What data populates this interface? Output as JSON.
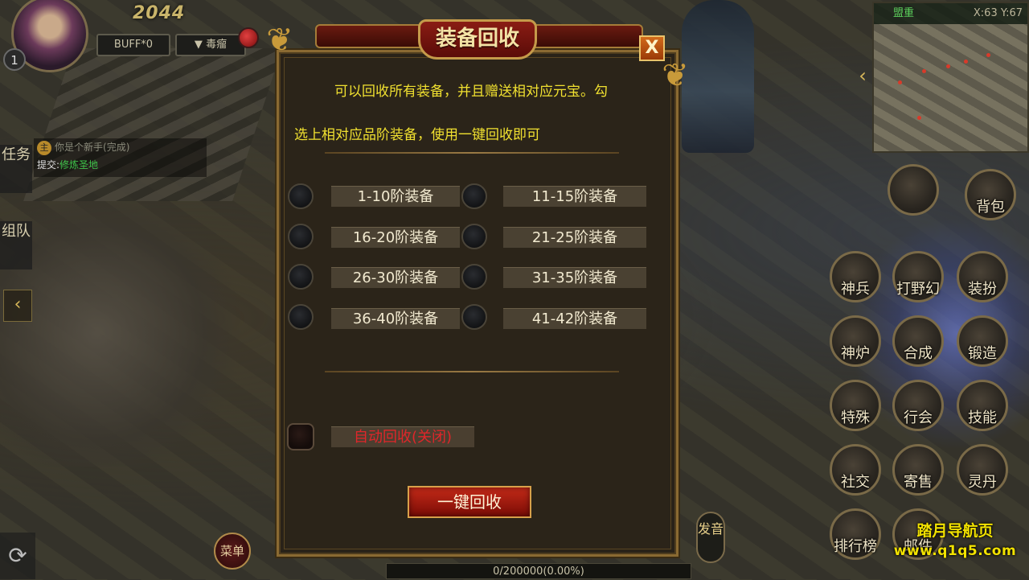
{
  "hud": {
    "hp_text": "2044",
    "level": "1",
    "buff_label": "BUFF*0",
    "poison_label": "毒瘤"
  },
  "side_tabs": {
    "tasks": "任务",
    "team": "组队",
    "arrow": "‹"
  },
  "quest": {
    "tag": "主",
    "title": "你是个新手",
    "status": "(完成)",
    "submit_prefix": "提交:",
    "submit_target": "修炼圣地"
  },
  "bottom": {
    "menu_label": "菜单",
    "speak_label": "发音",
    "exp_text": "0/200000(0.00%)"
  },
  "minimap": {
    "name": "盟重",
    "coord": "X:63 Y:67"
  },
  "skills": [
    {
      "label": "背包"
    },
    {
      "label": "神兵"
    },
    {
      "label": "打野幻"
    },
    {
      "label": "装扮"
    },
    {
      "label": "神炉"
    },
    {
      "label": "合成"
    },
    {
      "label": "锻造"
    },
    {
      "label": "特殊"
    },
    {
      "label": "行会"
    },
    {
      "label": "技能"
    },
    {
      "label": "社交"
    },
    {
      "label": "寄售"
    },
    {
      "label": "灵丹"
    },
    {
      "label": "排行榜"
    },
    {
      "label": "邮件"
    }
  ],
  "dialog": {
    "title": "装备回收",
    "close": "X",
    "desc_line1": "可以回收所有装备，并且赠送相对应元宝。勾",
    "desc_line2": "选上相对应品阶装备，使用一键回收即可",
    "tiers": [
      {
        "label": "1-10阶装备"
      },
      {
        "label": "11-15阶装备"
      },
      {
        "label": "16-20阶装备"
      },
      {
        "label": "21-25阶装备"
      },
      {
        "label": "26-30阶装备"
      },
      {
        "label": "31-35阶装备"
      },
      {
        "label": "36-40阶装备"
      },
      {
        "label": "41-42阶装备"
      }
    ],
    "auto_recycle": "自动回收(关闭)",
    "recycle_button": "一键回收"
  },
  "watermark": {
    "line1": "踏月导航页",
    "line2": "www.q1q5.com"
  },
  "colors": {
    "desc_yellow": "#f0e030",
    "auto_red": "#e0262a",
    "title_red": "#8a1c14",
    "frame_gold": "#8a6a32"
  }
}
